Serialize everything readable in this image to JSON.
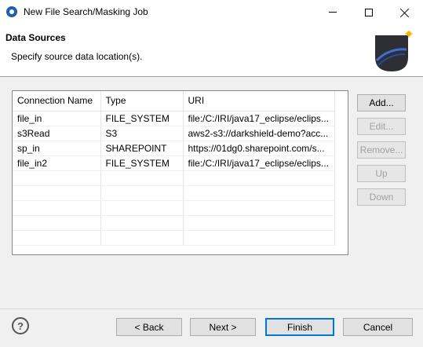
{
  "window": {
    "title": "New File Search/Masking Job"
  },
  "header": {
    "title": "Data Sources",
    "description": "Specify source data location(s)."
  },
  "table": {
    "columns": [
      "Connection Name",
      "Type",
      "URI"
    ],
    "rows": [
      [
        "file_in",
        "FILE_SYSTEM",
        "file:/C:/IRI/java17_eclipse/eclips..."
      ],
      [
        "s3Read",
        "S3",
        "aws2-s3://darkshield-demo?acc..."
      ],
      [
        "sp_in",
        "SHAREPOINT",
        "https://01dg0.sharepoint.com/s..."
      ],
      [
        "file_in2",
        "FILE_SYSTEM",
        "file:/C:/IRI/java17_eclipse/eclips..."
      ]
    ]
  },
  "side_buttons": {
    "add": "Add...",
    "edit": "Edit...",
    "remove": "Remove...",
    "up": "Up",
    "down": "Down"
  },
  "footer": {
    "back": "< Back",
    "next": "Next >",
    "finish": "Finish",
    "cancel": "Cancel",
    "help_glyph": "?"
  },
  "colors": {
    "accent": "#0078d7",
    "disabled_text": "#a0a0a0"
  },
  "icons": [
    "app-icon",
    "minimize-icon",
    "maximize-icon",
    "close-icon",
    "wizard-banner-icon",
    "help-icon"
  ]
}
